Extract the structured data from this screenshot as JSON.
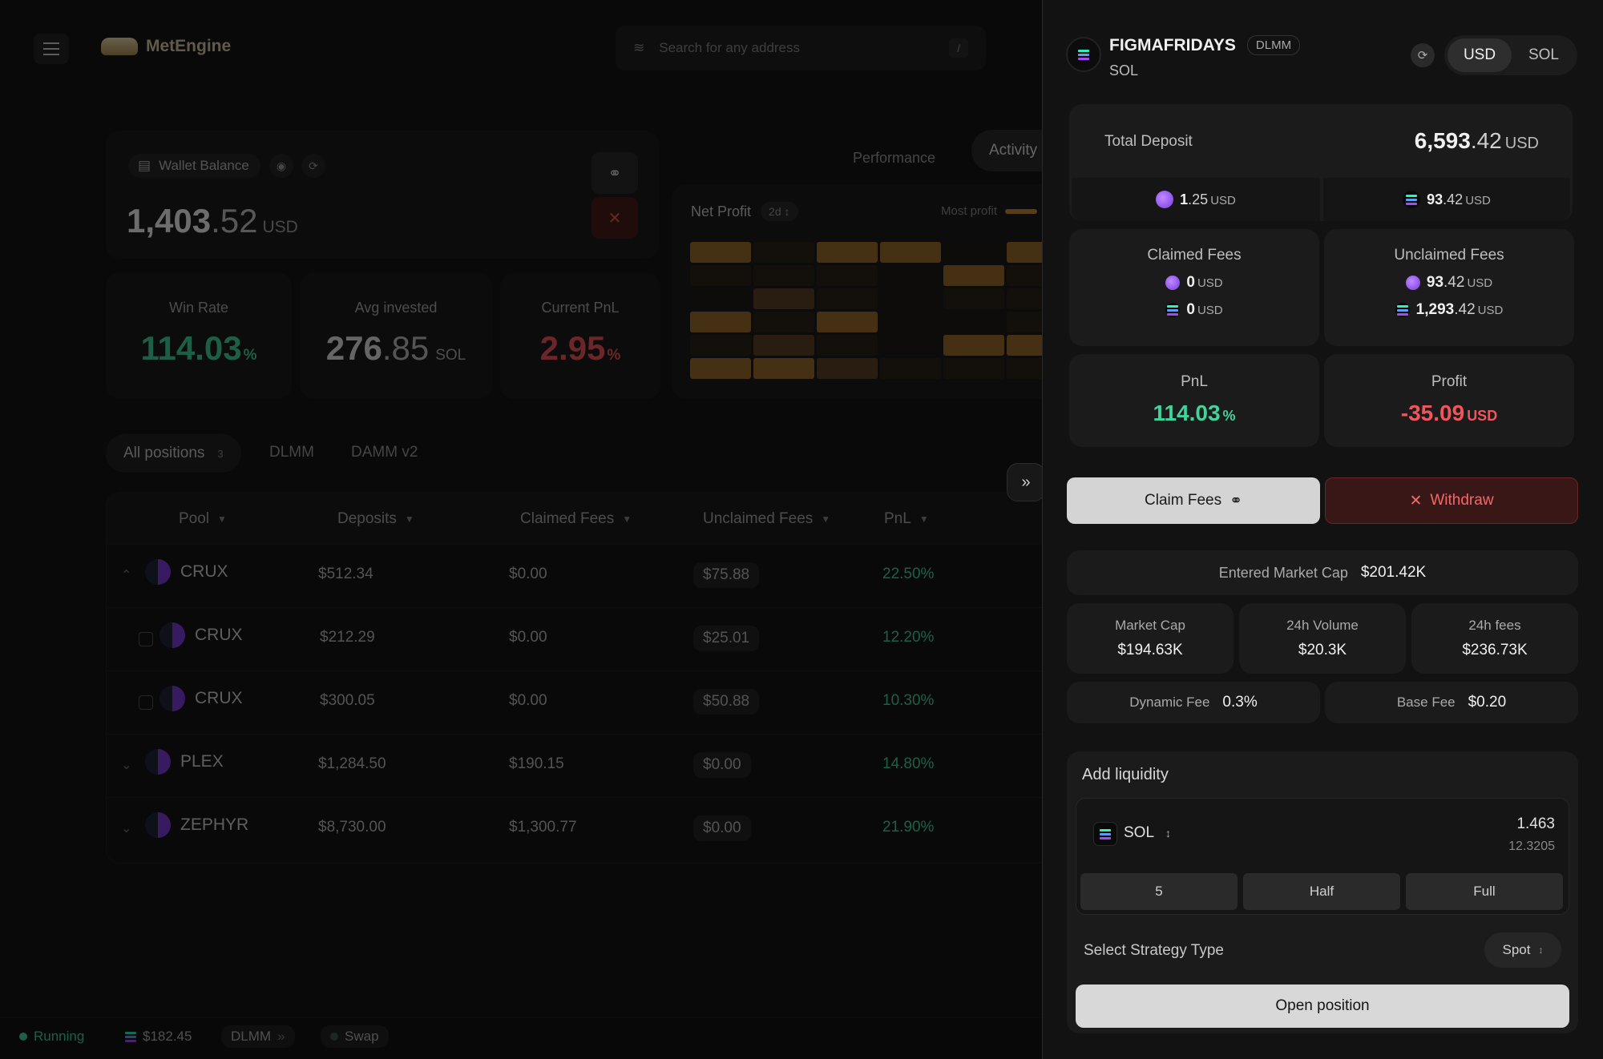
{
  "app": {
    "brand": "MetEngine",
    "search_placeholder": "Search for any address",
    "search_shortcut": "/"
  },
  "wallet": {
    "label": "Wallet Balance",
    "amount_int": "1,403",
    "amount_dec": ".52",
    "unit": "USD"
  },
  "stats": [
    {
      "label": "Win Rate",
      "value": "114.03",
      "unit": "%",
      "color": "#41d39b"
    },
    {
      "label": "Avg invested",
      "value_int": "276",
      "value_dec": ".85",
      "unit": "SOL"
    },
    {
      "label": "Current PnL",
      "value": "2.95",
      "unit": "%",
      "color": "#f0555b"
    }
  ],
  "view_tabs": {
    "performance": "Performance",
    "activity": "Activity"
  },
  "heatmap": {
    "title": "Net Profit",
    "range": "2d",
    "legend": "Most profit",
    "levels": [
      [
        3,
        1,
        3,
        3,
        0,
        3
      ],
      [
        1,
        1,
        1,
        0,
        3,
        1
      ],
      [
        0,
        2,
        1,
        0,
        1,
        1
      ],
      [
        3,
        1,
        3,
        0,
        0,
        1
      ],
      [
        1,
        2,
        1,
        0,
        3,
        3
      ],
      [
        3,
        3,
        2,
        1,
        1,
        1
      ]
    ]
  },
  "filters": {
    "all": "All positions",
    "count": "3",
    "dlmm": "DLMM",
    "damm": "DAMM v2"
  },
  "table": {
    "headers": [
      "Pool",
      "Deposits",
      "Claimed Fees",
      "Unclaimed Fees",
      "PnL"
    ],
    "rows": [
      {
        "pool": "CRUX",
        "deposit": "$512.34",
        "claimed": "$0.00",
        "unclaimed": "$75.88",
        "pnl": "22.50%",
        "kind": "expanded"
      },
      {
        "pool": "CRUX",
        "deposit": "$212.29",
        "claimed": "$0.00",
        "unclaimed": "$25.01",
        "pnl": "12.20%",
        "kind": "child"
      },
      {
        "pool": "CRUX",
        "deposit": "$300.05",
        "claimed": "$0.00",
        "unclaimed": "$50.88",
        "pnl": "10.30%",
        "kind": "child"
      },
      {
        "pool": "PLEX",
        "deposit": "$1,284.50",
        "claimed": "$190.15",
        "unclaimed": "$0.00",
        "pnl": "14.80%",
        "kind": "collapsed"
      },
      {
        "pool": "ZEPHYR",
        "deposit": "$8,730.00",
        "claimed": "$1,300.77",
        "unclaimed": "$0.00",
        "pnl": "21.90%",
        "kind": "collapsed"
      }
    ]
  },
  "statusbar": {
    "running": "Running",
    "price": "$182.45",
    "mode": "DLMM",
    "swap": "Swap"
  },
  "drawer": {
    "title": "FIGMAFRIDAYS",
    "tag": "DLMM",
    "subtitle": "SOL",
    "currency": {
      "usd": "USD",
      "sol": "SOL",
      "selected": "USD"
    },
    "total_deposit": {
      "label": "Total Deposit",
      "int": "6,593",
      "dec": ".42",
      "unit": "USD"
    },
    "deposit_split": [
      {
        "int": "1",
        "dec": ".25",
        "unit": "USD",
        "coin": "purple"
      },
      {
        "int": "93",
        "dec": ".42",
        "unit": "USD",
        "coin": "sol"
      }
    ],
    "claimed_fees": {
      "label": "Claimed Fees",
      "a_int": "0",
      "a_unit": "USD",
      "b_int": "0",
      "b_unit": "USD"
    },
    "unclaimed_fees": {
      "label": "Unclaimed Fees",
      "a_int": "93",
      "a_dec": ".42",
      "a_unit": "USD",
      "b_int": "1,293",
      "b_dec": ".42",
      "b_unit": "USD"
    },
    "pnl": {
      "label": "PnL",
      "value": "114.03",
      "unit": "%"
    },
    "profit": {
      "label": "Profit",
      "value": "-35.09",
      "unit": "USD"
    },
    "claim_label": "Claim Fees",
    "withdraw_label": "Withdraw",
    "entered_mcap": {
      "label": "Entered Market Cap",
      "value": "$201.42K"
    },
    "metrics": [
      {
        "label": "Market Cap",
        "value": "$194.63K"
      },
      {
        "label": "24h Volume",
        "value": "$20.3K"
      },
      {
        "label": "24h fees",
        "value": "$236.73K"
      }
    ],
    "dynamic_fee": {
      "label": "Dynamic Fee",
      "value": "0.3%"
    },
    "base_fee": {
      "label": "Base Fee",
      "value": "$0.20"
    },
    "liquidity": {
      "title": "Add liquidity",
      "token": "SOL",
      "amount": "1.463",
      "amount_sub": "12.3205",
      "presets": [
        "5",
        "Half",
        "Full"
      ],
      "strategy_label": "Select Strategy Type",
      "strategy": "Spot",
      "open_label": "Open position"
    }
  }
}
